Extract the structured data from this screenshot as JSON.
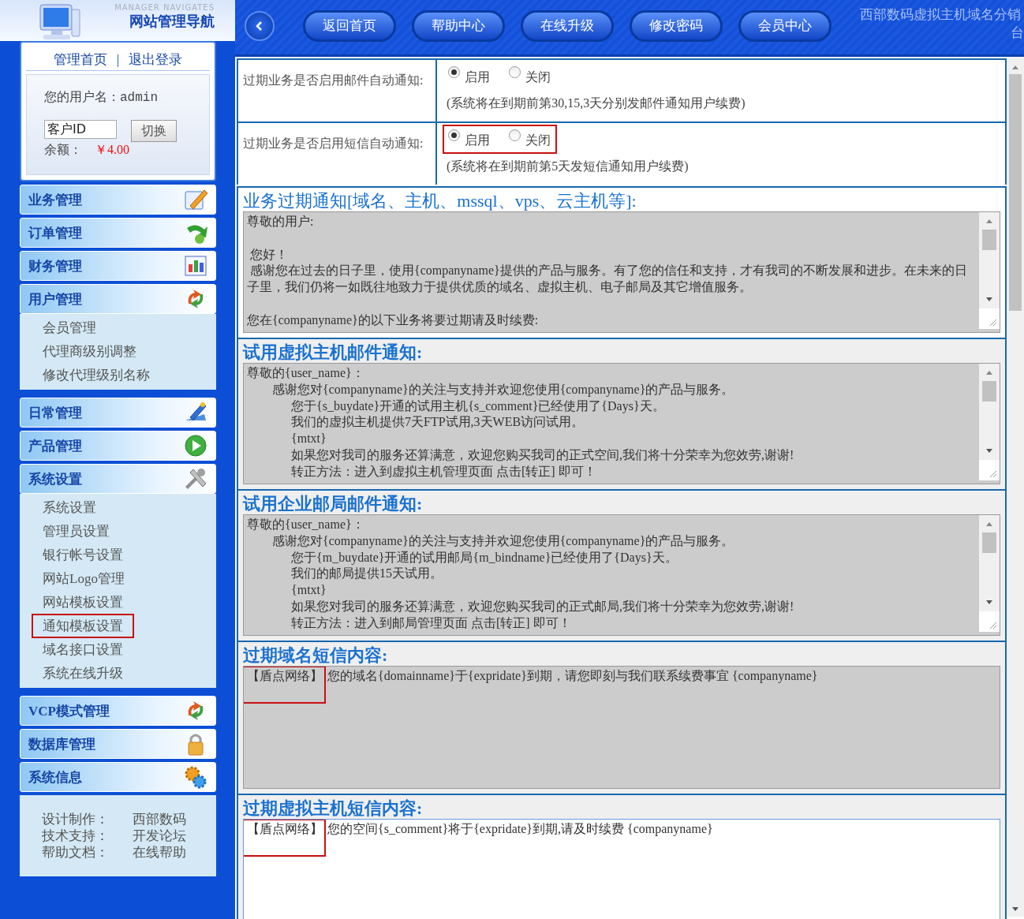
{
  "sidebar": {
    "logo_caption": "MANAGER NAVIGATES",
    "logo_title": "网站管理导航",
    "links": [
      {
        "label": "管理首页"
      },
      {
        "label": "退出登录"
      }
    ],
    "link_separator": "|",
    "user": {
      "name_label": "您的用户名：",
      "name": "admin",
      "client_id_value": "客户ID",
      "switch_button": "切换",
      "balance_label": "余额：",
      "balance": "￥4.00"
    },
    "groups": [
      {
        "label": "业务管理",
        "expanded": false
      },
      {
        "label": "订单管理",
        "expanded": false
      },
      {
        "label": "财务管理",
        "expanded": false
      },
      {
        "label": "用户管理",
        "expanded": true,
        "items": [
          {
            "label": "会员管理",
            "highlighted": false
          },
          {
            "label": "代理商级别调整",
            "highlighted": false
          },
          {
            "label": "修改代理级别名称",
            "highlighted": false
          }
        ]
      },
      {
        "label": "日常管理",
        "expanded": false
      },
      {
        "label": "产品管理",
        "expanded": false
      },
      {
        "label": "系统设置",
        "expanded": true,
        "items": [
          {
            "label": "系统设置",
            "highlighted": false
          },
          {
            "label": "管理员设置",
            "highlighted": false
          },
          {
            "label": "银行帐号设置",
            "highlighted": false
          },
          {
            "label": "网站Logo管理",
            "highlighted": false
          },
          {
            "label": "网站模板设置",
            "highlighted": false
          },
          {
            "label": "通知模板设置",
            "highlighted": true
          },
          {
            "label": "域名接口设置",
            "highlighted": false
          },
          {
            "label": "系统在线升级",
            "highlighted": false
          }
        ]
      },
      {
        "label": "VCP模式管理",
        "expanded": false
      },
      {
        "label": "数据库管理",
        "expanded": false
      },
      {
        "label": "系统信息",
        "expanded": false
      }
    ],
    "footer": [
      {
        "label": "设计制作：",
        "value": "西部数码"
      },
      {
        "label": "技术支持：",
        "value": "开发论坛"
      },
      {
        "label": "帮助文档：",
        "value": "在线帮助"
      }
    ]
  },
  "top_bar": {
    "buttons": [
      "返回首页",
      "帮助中心",
      "在线升级",
      "修改密码",
      "会员中心"
    ],
    "title_line_1": "西部数码虚拟主机域名分销",
    "title_line_2": "台"
  },
  "settings": [
    {
      "label": "过期业务是否启用邮件自动通知:",
      "options": [
        {
          "label": "启用",
          "selected": true
        },
        {
          "label": "关闭",
          "selected": false
        }
      ],
      "note": "(系统将在到期前第30,15,3天分别发邮件通知用户续费)",
      "highlighted": false
    },
    {
      "label": "过期业务是否启用短信自动通知:",
      "options": [
        {
          "label": "启用",
          "selected": true
        },
        {
          "label": "关闭",
          "selected": false
        }
      ],
      "note": "(系统将在到期前第5天发短信通知用户续费)",
      "highlighted": true
    }
  ],
  "templates": [
    {
      "title": "业务过期通知[域名、主机、mssql、vps、云主机等]:",
      "focused": false,
      "paragraphs": [
        {
          "lines": [
            "尊敬的用户:"
          ]
        },
        {
          "lines": [
            " 您好！",
            " 感谢您在过去的日子里，使用{companyname}提供的产品与服务。有了您的信任和支持，才有我司的不断发展和进步。在未来的日子里，我们仍将一如既往地致力于提供优质的域名、虚拟主机、电子邮局及其它增值服务。"
          ]
        },
        {
          "lines": [
            "您在{companyname}的以下业务将要过期请及时续费:"
          ]
        }
      ]
    },
    {
      "title": "试用虚拟主机邮件通知:",
      "focused": false,
      "paragraphs": [
        {
          "lines": [
            "尊敬的{user_name}：",
            "        感谢您对{companyname}的关注与支持并欢迎您使用{companyname}的产品与服务。",
            "              您于{s_buydate}开通的试用主机{s_comment}已经使用了{Days}天。",
            "              我们的虚拟主机提供7天FTP试用,3天WEB访问试用。",
            "              {mtxt}",
            "              如果您对我司的服务还算满意，欢迎您购买我司的正式空间,我们将十分荣幸为您效劳,谢谢!",
            "              转正方法：进入到虚拟主机管理页面 点击[转正] 即可！"
          ]
        }
      ]
    },
    {
      "title": "试用企业邮局邮件通知:",
      "focused": false,
      "paragraphs": [
        {
          "lines": [
            "尊敬的{user_name}：",
            "        感谢您对{companyname}的关注与支持并欢迎您使用{companyname}的产品与服务。",
            "              您于{m_buydate}开通的试用邮局{m_bindname}已经使用了{Days}天。",
            "              我们的邮局提供15天试用。",
            "              {mtxt}",
            "              如果您对我司的服务还算满意，欢迎您购买我司的正式邮局,我们将十分荣幸为您效劳,谢谢!",
            "              转正方法：进入到邮局管理页面 点击[转正] 即可！"
          ]
        }
      ]
    },
    {
      "title": "过期域名短信内容:",
      "focused": false,
      "prefix": "【盾点网络】",
      "prefix_highlighted": true,
      "paragraphs": [
        {
          "lines": [
            "您的域名{domainname}于{expridate}到期，请您即刻与我们联系续费事宜 {companyname}"
          ]
        }
      ]
    },
    {
      "title": "过期虚拟主机短信内容:",
      "focused": true,
      "prefix": "【盾点网络】",
      "prefix_highlighted": true,
      "paragraphs": [
        {
          "lines": [
            "您的空间{s_comment}将于{expridate}到期,请及时续费 {companyname}"
          ]
        }
      ]
    }
  ]
}
